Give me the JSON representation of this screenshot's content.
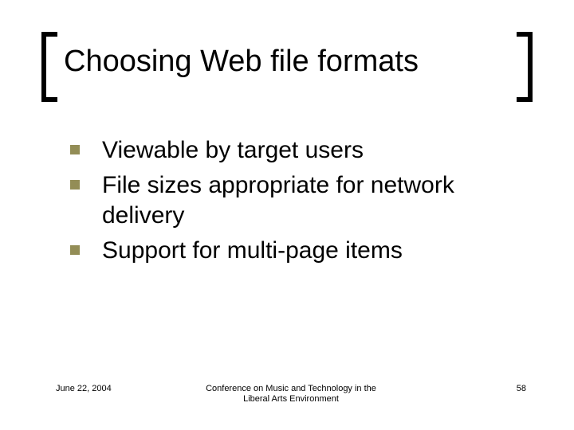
{
  "title": "Choosing Web file formats",
  "bullets": [
    "Viewable by target users",
    "File sizes appropriate for network delivery",
    "Support for multi-page items"
  ],
  "footer": {
    "date": "June 22, 2004",
    "center_line1": "Conference on Music and Technology in the",
    "center_line2": "Liberal Arts Environment",
    "page": "58"
  },
  "colors": {
    "bullet": "#938d56"
  }
}
